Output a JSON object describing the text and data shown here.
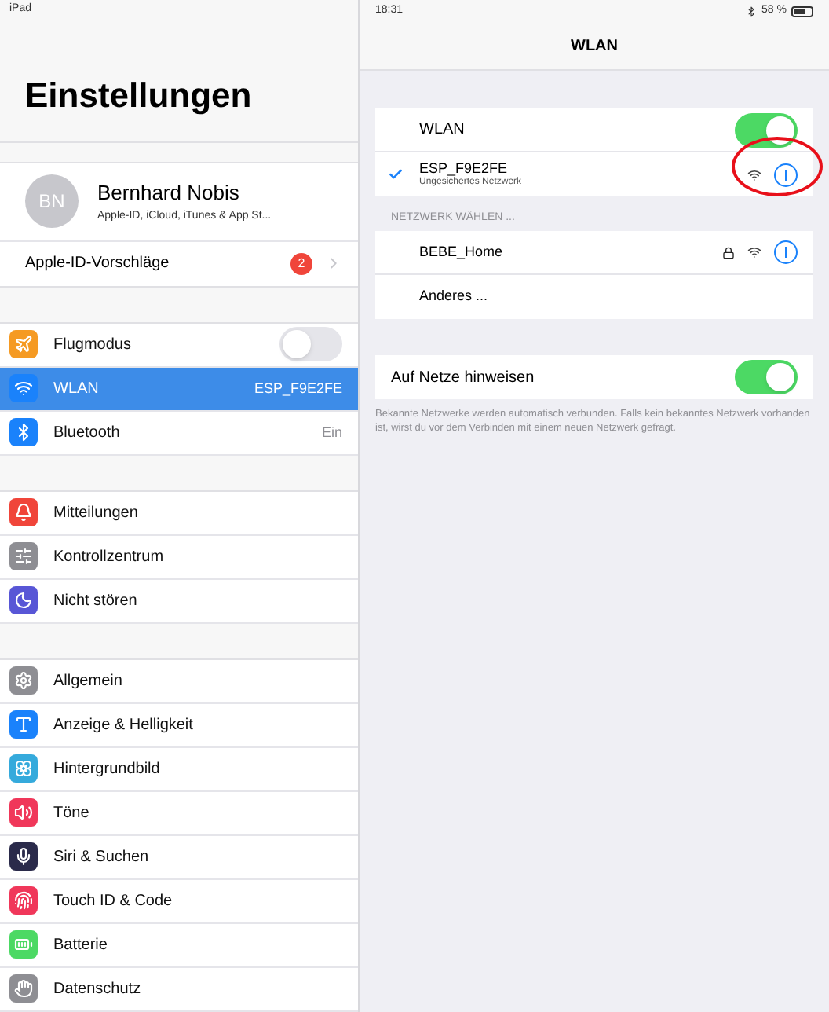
{
  "status_bar": {
    "device": "iPad",
    "time": "18:31",
    "battery": "58 %"
  },
  "sidebar": {
    "title": "Einstellungen",
    "profile": {
      "initials": "BN",
      "name": "Bernhard Nobis",
      "subtitle": "Apple-ID, iCloud, iTunes & App St..."
    },
    "suggestions": {
      "label": "Apple-ID-Vorschläge",
      "badge": "2"
    },
    "groups": [
      [
        {
          "label": "Flugmodus",
          "kind": "toggle",
          "on": false,
          "selected": false,
          "color": "#f59a23"
        },
        {
          "label": "WLAN",
          "kind": "value",
          "value": "ESP_F9E2FE",
          "selected": true,
          "color": "#1a82fb"
        },
        {
          "label": "Bluetooth",
          "kind": "value",
          "value": "Ein",
          "selected": false,
          "color": "#1a82fb"
        }
      ],
      [
        {
          "label": "Mitteilungen",
          "kind": "plain",
          "selected": false,
          "color": "#f0453a"
        },
        {
          "label": "Kontrollzentrum",
          "kind": "plain",
          "selected": false,
          "color": "#8e8e93"
        },
        {
          "label": "Nicht stören",
          "kind": "plain",
          "selected": false,
          "color": "#5856d6"
        }
      ],
      [
        {
          "label": "Allgemein",
          "kind": "plain",
          "selected": false,
          "color": "#8e8e93"
        },
        {
          "label": "Anzeige & Helligkeit",
          "kind": "plain",
          "selected": false,
          "color": "#1a82fb"
        },
        {
          "label": "Hintergrundbild",
          "kind": "plain",
          "selected": false,
          "color": "#35aadc"
        },
        {
          "label": "Töne",
          "kind": "plain",
          "selected": false,
          "color": "#f0375a"
        },
        {
          "label": "Siri & Suchen",
          "kind": "plain",
          "selected": false,
          "color": "#2a2a4a"
        },
        {
          "label": "Touch ID & Code",
          "kind": "plain",
          "selected": false,
          "color": "#f0375a"
        },
        {
          "label": "Batterie",
          "kind": "plain",
          "selected": false,
          "color": "#4cd964"
        },
        {
          "label": "Datenschutz",
          "kind": "plain",
          "selected": false,
          "color": "#8e8e93"
        }
      ]
    ]
  },
  "detail": {
    "title": "WLAN",
    "wlan": {
      "label": "WLAN",
      "on": true
    },
    "connected": {
      "name": "ESP_F9E2FE",
      "subtitle": "Ungesichertes Netzwerk",
      "checked": true
    },
    "section_header": "NETZWERK WÄHLEN ...",
    "networks": [
      {
        "name": "BEBE_Home",
        "locked": true
      }
    ],
    "other": "Anderes ...",
    "ask": {
      "label": "Auf Netze hinweisen",
      "on": true
    },
    "footer": "Bekannte Netzwerke werden automatisch verbunden. Falls kein bekanntes Netzwerk vorhanden ist, wirst du vor dem Verbinden mit einem neuen Netzwerk gefragt."
  }
}
